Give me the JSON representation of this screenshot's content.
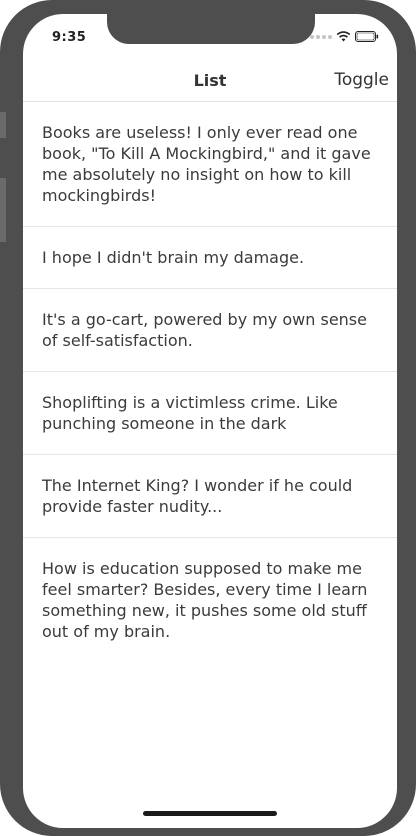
{
  "status_bar": {
    "time": "9:35",
    "wifi_icon": "wifi-icon",
    "battery_icon": "battery-icon"
  },
  "nav": {
    "title": "List",
    "toggle_label": "Toggle"
  },
  "items": [
    {
      "text": "Books are useless! I only ever read one book, \"To Kill A Mockingbird,\" and it gave me absolutely no insight on how to kill mockingbirds!"
    },
    {
      "text": "I hope I didn't brain my damage."
    },
    {
      "text": "It's a go-cart, powered by my own sense of self-satisfaction."
    },
    {
      "text": "Shoplifting is a victimless crime. Like punching someone in the dark"
    },
    {
      "text": "The Internet King? I wonder if he could provide faster nudity..."
    },
    {
      "text": "How is education supposed to make me feel smarter? Besides, every time I learn something new, it pushes some old stuff out of my brain."
    }
  ],
  "colors": {
    "bezel": "#4e4e4e",
    "text": "#3b3b3b",
    "separator": "#e6e6e6"
  }
}
